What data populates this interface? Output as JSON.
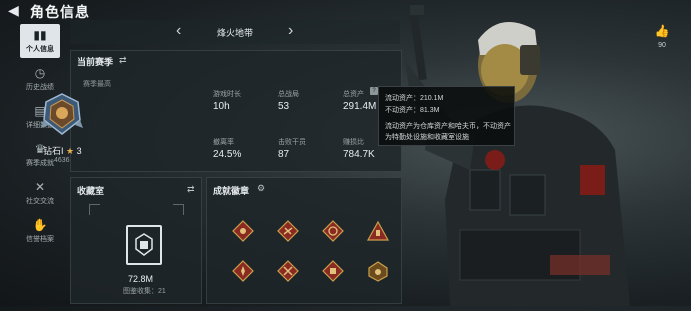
{
  "header": {
    "title": "角色信息"
  },
  "sidebar": {
    "items": [
      {
        "label": "个人信息",
        "icon": "bar-chart-icon",
        "active": true
      },
      {
        "label": "历史战绩",
        "icon": "clock-icon",
        "active": false
      },
      {
        "label": "详细数据",
        "icon": "table-icon",
        "active": false
      },
      {
        "label": "赛季成就",
        "icon": "trophy-icon",
        "active": false
      },
      {
        "label": "社交交流",
        "icon": "tools-icon",
        "active": false
      },
      {
        "label": "信誉档案",
        "icon": "handshake-icon",
        "active": false
      }
    ]
  },
  "season_nav": {
    "name": "烽火地带"
  },
  "stats_panel": {
    "title": "当前赛季",
    "subtitle": "赛季最高",
    "rank": {
      "name": "钻石I",
      "stars": "3",
      "points": "4636"
    },
    "stats": [
      {
        "label": "游戏时长",
        "value": "10h"
      },
      {
        "label": "总战局",
        "value": "53"
      },
      {
        "label": "总资产",
        "value": "291.4M"
      },
      {
        "label": "撤离率",
        "value": "24.5%"
      },
      {
        "label": "击败干员",
        "value": "87"
      },
      {
        "label": "赚损比",
        "value": "784.7K"
      }
    ]
  },
  "tooltip": {
    "liquid": "流动资产：210.1M",
    "fixed": "不动资产：81.3M",
    "note_line1": "流动资产为仓库资产和哈夫币，不动资产",
    "note_line2": "为特勤处设施和收藏室设施"
  },
  "collection": {
    "title": "收藏室",
    "value": "72.8M",
    "count_label": "图鉴收集：21"
  },
  "achievements": {
    "title": "成就徽章"
  },
  "likes": {
    "count": "90"
  },
  "colors": {
    "accent": "#dfe5e8",
    "medal_red": "#8a2a22",
    "medal_gold": "#c9a14a"
  }
}
